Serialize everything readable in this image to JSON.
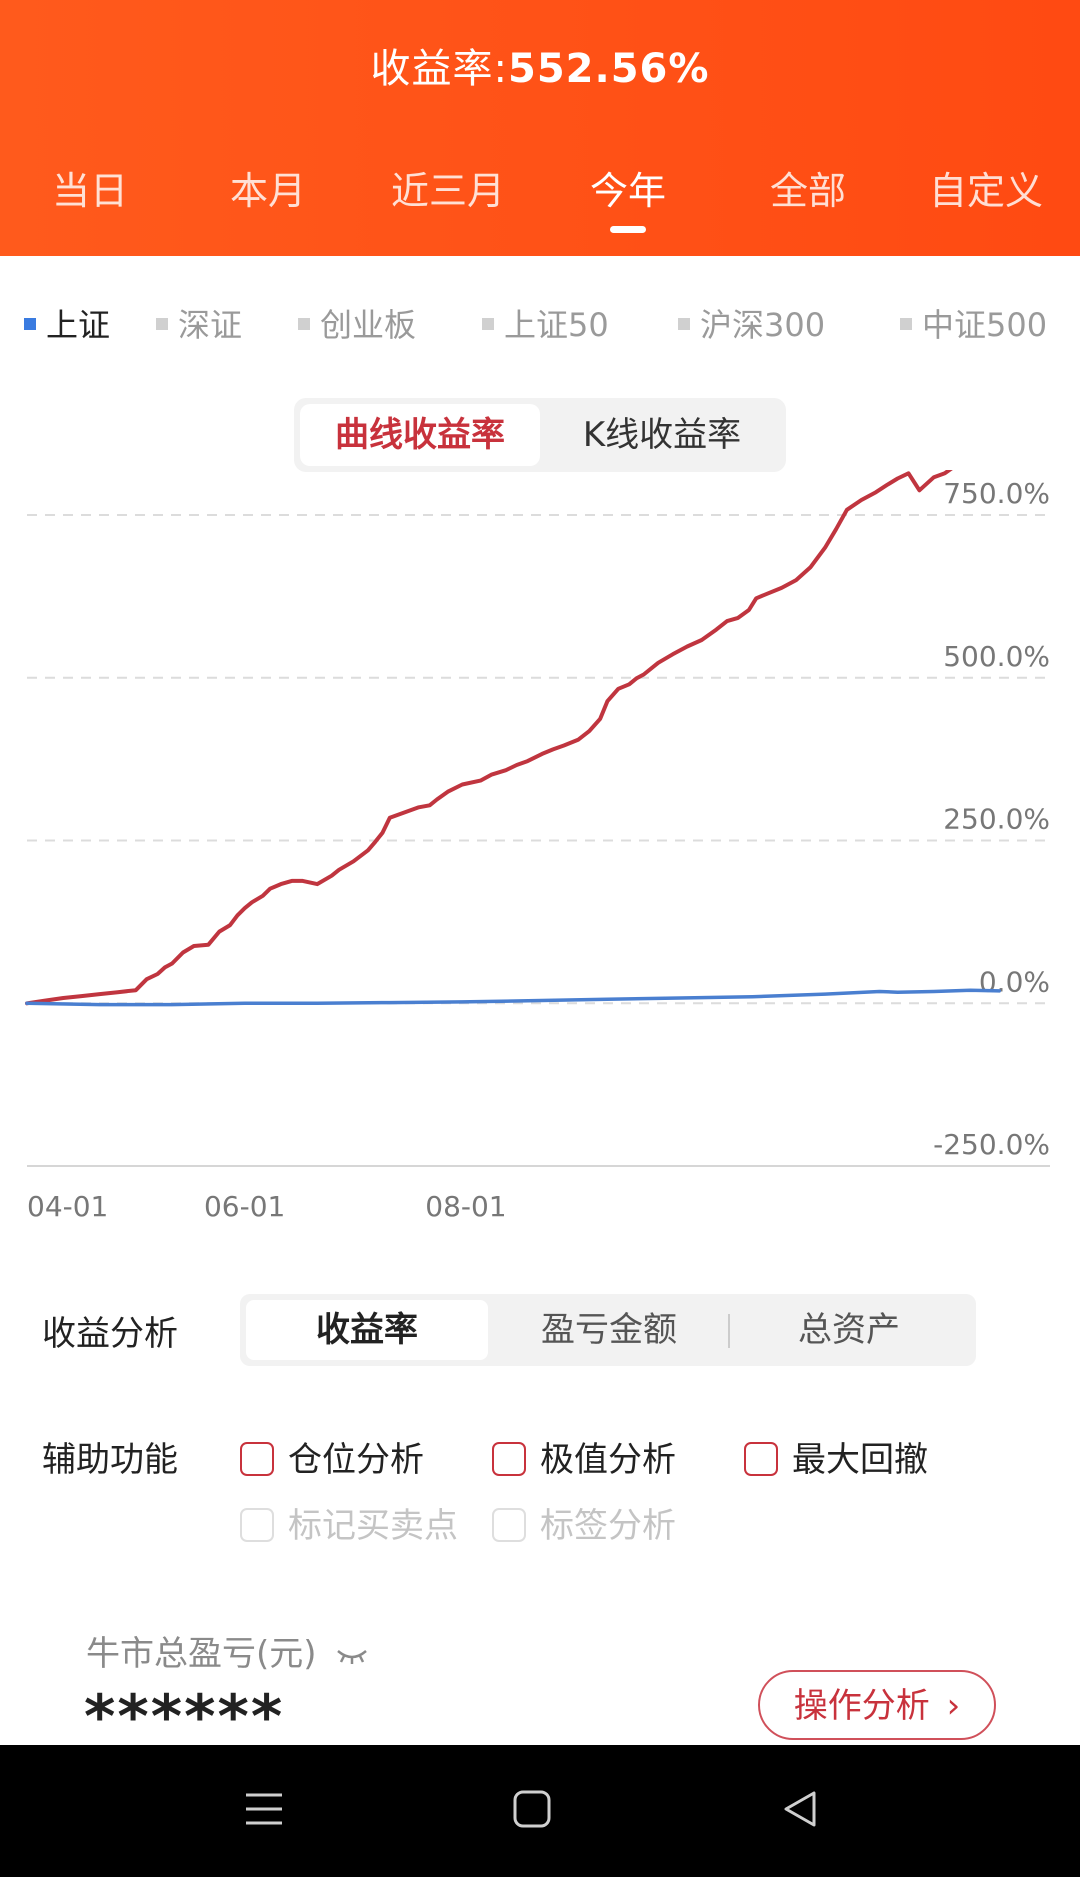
{
  "header": {
    "title_label": "收益率:",
    "title_value": "552.56%",
    "tabs": [
      {
        "label": "当日"
      },
      {
        "label": "本月"
      },
      {
        "label": "近三月"
      },
      {
        "label": "今年"
      },
      {
        "label": "全部"
      },
      {
        "label": "自定义"
      }
    ],
    "active_tab": "今年"
  },
  "indices": [
    {
      "label": "上证"
    },
    {
      "label": "深证"
    },
    {
      "label": "创业板"
    },
    {
      "label": "上证50"
    },
    {
      "label": "沪深300"
    },
    {
      "label": "中证500"
    }
  ],
  "active_index": "上证",
  "chart_mode": {
    "options": [
      {
        "label": "曲线收益率"
      },
      {
        "label": "K线收益率"
      }
    ],
    "selected": "曲线收益率"
  },
  "chart_data": {
    "type": "line",
    "x_tick_labels": [
      "04-01",
      "06-01",
      "08-01"
    ],
    "y_tick_labels": [
      "750.0%",
      "500.0%",
      "250.0%",
      "0.0%",
      "-250.0%"
    ],
    "ylim": [
      -250,
      750
    ],
    "x_unit": "days since start",
    "xlim": [
      0,
      282
    ],
    "x_tick_positions": [
      0,
      60,
      121
    ],
    "grid": true,
    "colors": {
      "portfolio": "#c0353f",
      "index": "#4a7fd0"
    },
    "series": [
      {
        "x": [
          0,
          5,
          10,
          15,
          20,
          25,
          30,
          33,
          36,
          38,
          40,
          43,
          46,
          50,
          53,
          56,
          58,
          60,
          62,
          65,
          67,
          70,
          73,
          76,
          80,
          84,
          86,
          90,
          94,
          96,
          98,
          100,
          104,
          108,
          111,
          113,
          116,
          120,
          125,
          128,
          132,
          135,
          138,
          142,
          145,
          148,
          152,
          155,
          158,
          160,
          163,
          166,
          168,
          170,
          174,
          178,
          182,
          186,
          190,
          193,
          196,
          199,
          201,
          204,
          208,
          212,
          216,
          220,
          223,
          226,
          230,
          234,
          237,
          240,
          243,
          246,
          250,
          253,
          256,
          260,
          262,
          265,
          268
        ],
        "y": [
          0,
          4,
          8,
          11,
          14,
          17,
          20,
          37,
          45,
          55,
          61,
          78,
          88,
          90,
          110,
          120,
          135,
          146,
          155,
          165,
          176,
          183,
          188,
          188,
          183,
          196,
          205,
          218,
          235,
          248,
          262,
          285,
          293,
          301,
          304,
          313,
          325,
          336,
          342,
          351,
          358,
          366,
          372,
          383,
          390,
          396,
          405,
          418,
          437,
          464,
          483,
          490,
          499,
          505,
          523,
          536,
          548,
          558,
          574,
          587,
          592,
          604,
          622,
          629,
          638,
          650,
          670,
          700,
          728,
          758,
          773,
          785,
          796,
          806,
          814,
          788,
          808,
          814,
          826,
          858,
          875,
          886,
          904
        ]
      },
      {
        "x": [
          0,
          20,
          40,
          60,
          80,
          100,
          120,
          140,
          160,
          180,
          200,
          220,
          235,
          240,
          250,
          260,
          268
        ],
        "y": [
          0,
          -2,
          -2,
          0,
          0,
          1,
          2,
          4,
          6,
          8,
          10,
          14,
          18,
          17,
          18,
          20,
          19
        ]
      }
    ]
  },
  "analysis": {
    "label": "收益分析",
    "options": [
      {
        "label": "收益率"
      },
      {
        "label": "盈亏金额"
      },
      {
        "label": "总资产"
      }
    ],
    "selected": "收益率"
  },
  "assist": {
    "label": "辅助功能",
    "options": [
      {
        "label": "仓位分析",
        "enabled": true
      },
      {
        "label": "极值分析",
        "enabled": true
      },
      {
        "label": "最大回撤",
        "enabled": true
      },
      {
        "label": "标记买卖点",
        "enabled": false
      },
      {
        "label": "标签分析",
        "enabled": false
      }
    ]
  },
  "pnl": {
    "label": "牛市总盈亏(元)",
    "value": "******",
    "button_label": "操作分析",
    "eye_icon": "eye-closed-icon"
  },
  "navbar": {
    "icons": [
      "menu-icon",
      "home-icon",
      "back-icon"
    ]
  }
}
